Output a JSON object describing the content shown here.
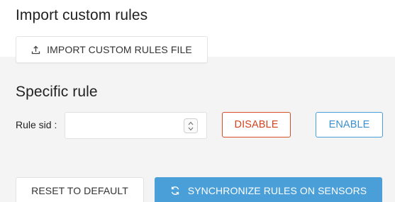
{
  "import_section": {
    "heading": "Import custom rules",
    "import_button_label": "IMPORT CUSTOM RULES FILE",
    "import_icon": "upload-icon"
  },
  "specific_rule": {
    "heading": "Specific rule",
    "rule_sid_label": "Rule sid :",
    "rule_sid_value": "",
    "rule_sid_placeholder": "",
    "spinner_icon": "spinner-arrows-icon",
    "disable_label": "DISABLE",
    "enable_label": "ENABLE"
  },
  "actions": {
    "reset_label": "RESET TO DEFAULT",
    "sync_label": "SYNCHRONIZE RULES ON SENSORS",
    "sync_icon": "sync-icon"
  },
  "colors": {
    "accent_blue": "#4a9fd8",
    "danger_red": "#d1441f",
    "panel_gray": "#f4f4f4"
  }
}
